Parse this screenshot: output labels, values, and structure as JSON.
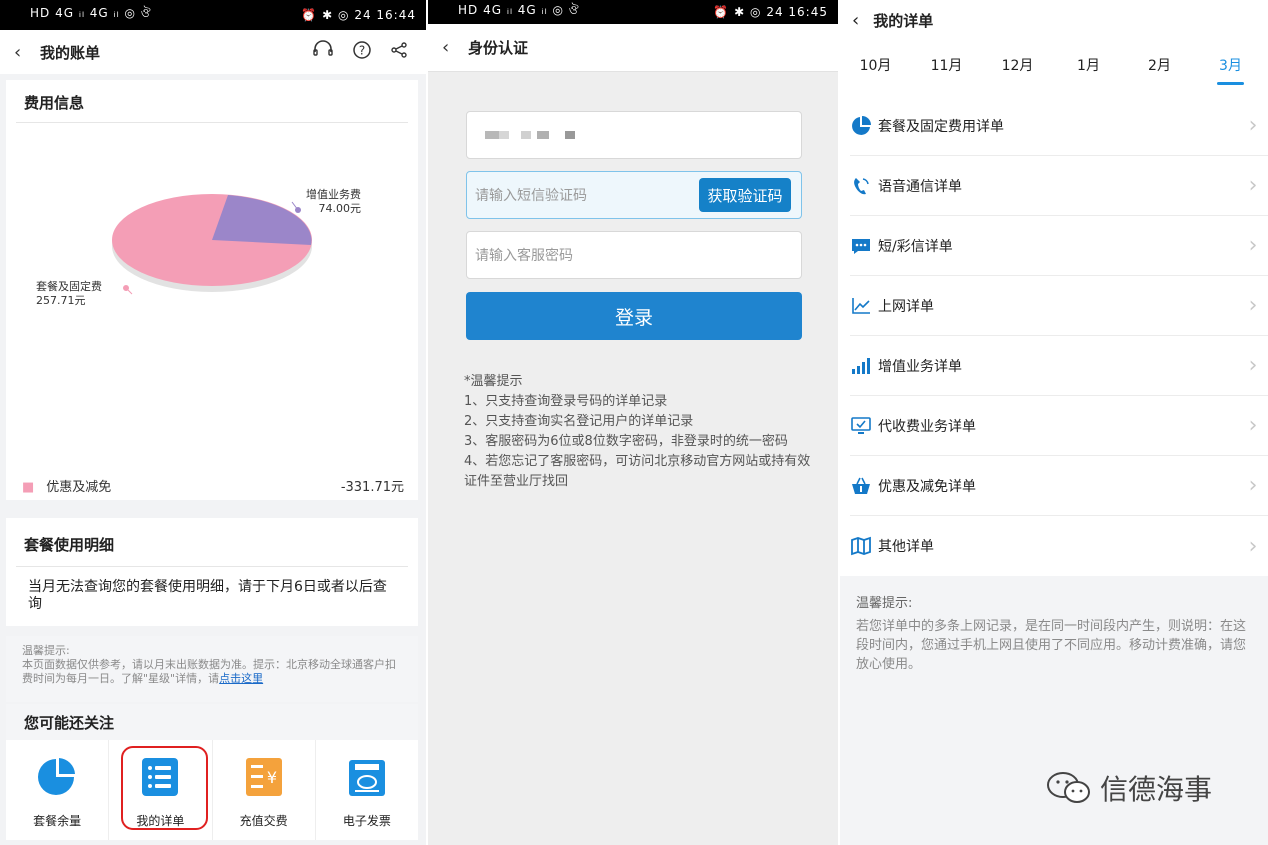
{
  "panel1": {
    "status_left": "HD 4G ᵢₗ 4G ᵢₗ ◎ ঔ",
    "status_right": "⏰ ✱ ◎ 24 16:44",
    "nav_title": "我的账单",
    "fee_section_title": "费用信息",
    "pie": {
      "slices": [
        {
          "label": "增值业务费",
          "value_text": "74.00元",
          "value": 74.0,
          "color": "#9b86c9"
        },
        {
          "label": "套餐及固定费",
          "value_text": "257.71元",
          "value": 257.71,
          "color": "#f49eb6"
        }
      ]
    },
    "discount_label": "优惠及减免",
    "discount_value": "-331.71元",
    "package_section_title": "套餐使用明细",
    "package_notice": "当月无法查询您的套餐使用明细，请于下月6日或者以后查询",
    "tip_title": "温馨提示:",
    "tip_text": "本页面数据仅供参考，请以月末出账数据为准。提示：北京移动全球通客户扣费时间为每月一日。了解\"星级\"详情，请",
    "tip_link": "点击这里",
    "follow_title": "您可能还关注",
    "shortcuts": [
      {
        "label": "套餐余量",
        "icon": "pie-chart-icon"
      },
      {
        "label": "我的详单",
        "icon": "list-icon"
      },
      {
        "label": "充值交费",
        "icon": "recharge-icon"
      },
      {
        "label": "电子发票",
        "icon": "invoice-icon"
      }
    ]
  },
  "panel2": {
    "status_left": "HD 4G ᵢₗ 4G ᵢₗ ◎ ঔ",
    "status_right": "⏰ ✱ ◎ 24 16:45",
    "nav_title": "身份认证",
    "sms_placeholder": "请输入短信验证码",
    "get_code_label": "获取验证码",
    "password_placeholder": "请输入客服密码",
    "login_label": "登录",
    "notes_title": "*温馨提示",
    "notes": [
      "1、只支持查询登录号码的详单记录",
      "2、只支持查询实名登记用户的详单记录",
      "3、客服密码为6位或8位数字密码，非登录时的统一密码",
      "4、若您忘记了客服密码，可访问北京移动官方网站或持有效证件至营业厅找回"
    ]
  },
  "panel3": {
    "title": "我的详单",
    "months": [
      "10月",
      "11月",
      "12月",
      "1月",
      "2月",
      "3月"
    ],
    "selected_month": "3月",
    "items": [
      {
        "label": "套餐及固定费用详单",
        "icon": "pie-icon"
      },
      {
        "label": "语音通信详单",
        "icon": "phone-icon"
      },
      {
        "label": "短/彩信详单",
        "icon": "message-icon"
      },
      {
        "label": "上网详单",
        "icon": "line-chart-icon"
      },
      {
        "label": "增值业务详单",
        "icon": "signal-bars-icon"
      },
      {
        "label": "代收费业务详单",
        "icon": "monitor-icon"
      },
      {
        "label": "优惠及减免详单",
        "icon": "basket-icon"
      },
      {
        "label": "其他详单",
        "icon": "map-icon"
      }
    ],
    "tip_title": "温馨提示:",
    "tip_text": "若您详单中的多条上网记录，是在同一时间段内产生，则说明：在这段时间内，您通过手机上网且使用了不同应用。移动计费准确，请您放心使用。",
    "watermark": "信德海事"
  }
}
